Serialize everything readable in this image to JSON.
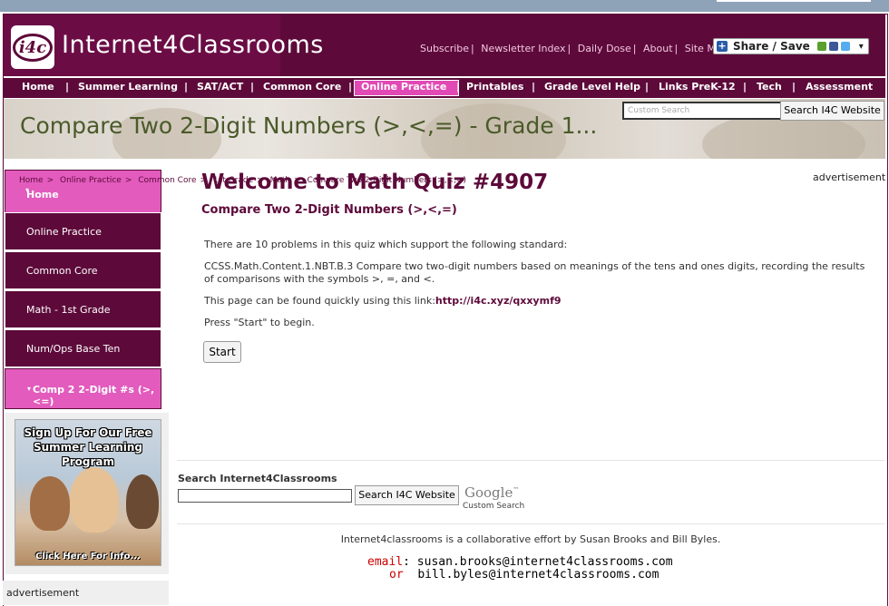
{
  "header": {
    "logo_badge": "i4c",
    "logo_text": "Internet4Classrooms",
    "top_links": [
      "Subscribe",
      "Newsletter Index",
      "Daily Dose",
      "About",
      "Site Map"
    ],
    "share_label": "Share / Save"
  },
  "nav": {
    "items": [
      "Home",
      "Summer Learning",
      "SAT/ACT",
      "Common Core",
      "Online Practice",
      "Printables",
      "Grade Level Help",
      "Links PreK-12",
      "Tech",
      "Assessment"
    ],
    "active": "Online Practice"
  },
  "banner": {
    "title": "Compare Two 2-Digit Numbers (>,<,=) - Grade 1...",
    "search_placeholder": "Custom Search",
    "search_button": "Search I4C Website"
  },
  "breadcrumbs": [
    "Home",
    "Online Practice",
    "Common Core",
    "1st Grade",
    "Math",
    "Compare Two 2-Digit Numbers (>,<,=)"
  ],
  "sidebar": {
    "items": [
      "Home",
      "Online Practice",
      "Common Core",
      "Math - 1st Grade",
      "Num/Ops Base Ten",
      "Comp 2 2-Digit #s (>,<=)"
    ]
  },
  "promo": {
    "headline": "Sign Up For Our Free Summer Learning Program",
    "cta": "Click Here For Info..."
  },
  "ads": {
    "left": "advertisement",
    "right": "advertisement"
  },
  "quiz": {
    "title": "Welcome to Math Quiz #4907",
    "subtitle": "Compare Two 2-Digit Numbers (>,<,=)",
    "intro": "There are 10 problems in this quiz which support the following standard:",
    "standard": "CCSS.Math.Content.1.NBT.B.3 Compare two two-digit numbers based on meanings of the tens and ones digits, recording the results of comparisons with the symbols >, =, and <.",
    "link_text": "This page can be found quickly using this link:",
    "link_url": "http://i4c.xyz/qxxymf9",
    "press_start": "Press \"Start\" to begin.",
    "start_button": "Start"
  },
  "site_search": {
    "label": "Search Internet4Classrooms",
    "button": "Search I4C Website",
    "google": "Google",
    "google_tm": "™",
    "google_caption": "Custom Search"
  },
  "footer": {
    "credit": "Internet4classrooms is a collaborative effort by Susan Brooks and Bill Byles.",
    "email_label": "email",
    "email_1": "susan.brooks@internet4classrooms.com",
    "or_label": "or",
    "email_2": "bill.byles@internet4classrooms.com"
  },
  "colors": {
    "brand": "#5d0a3a",
    "accent": "#e25bbd"
  }
}
